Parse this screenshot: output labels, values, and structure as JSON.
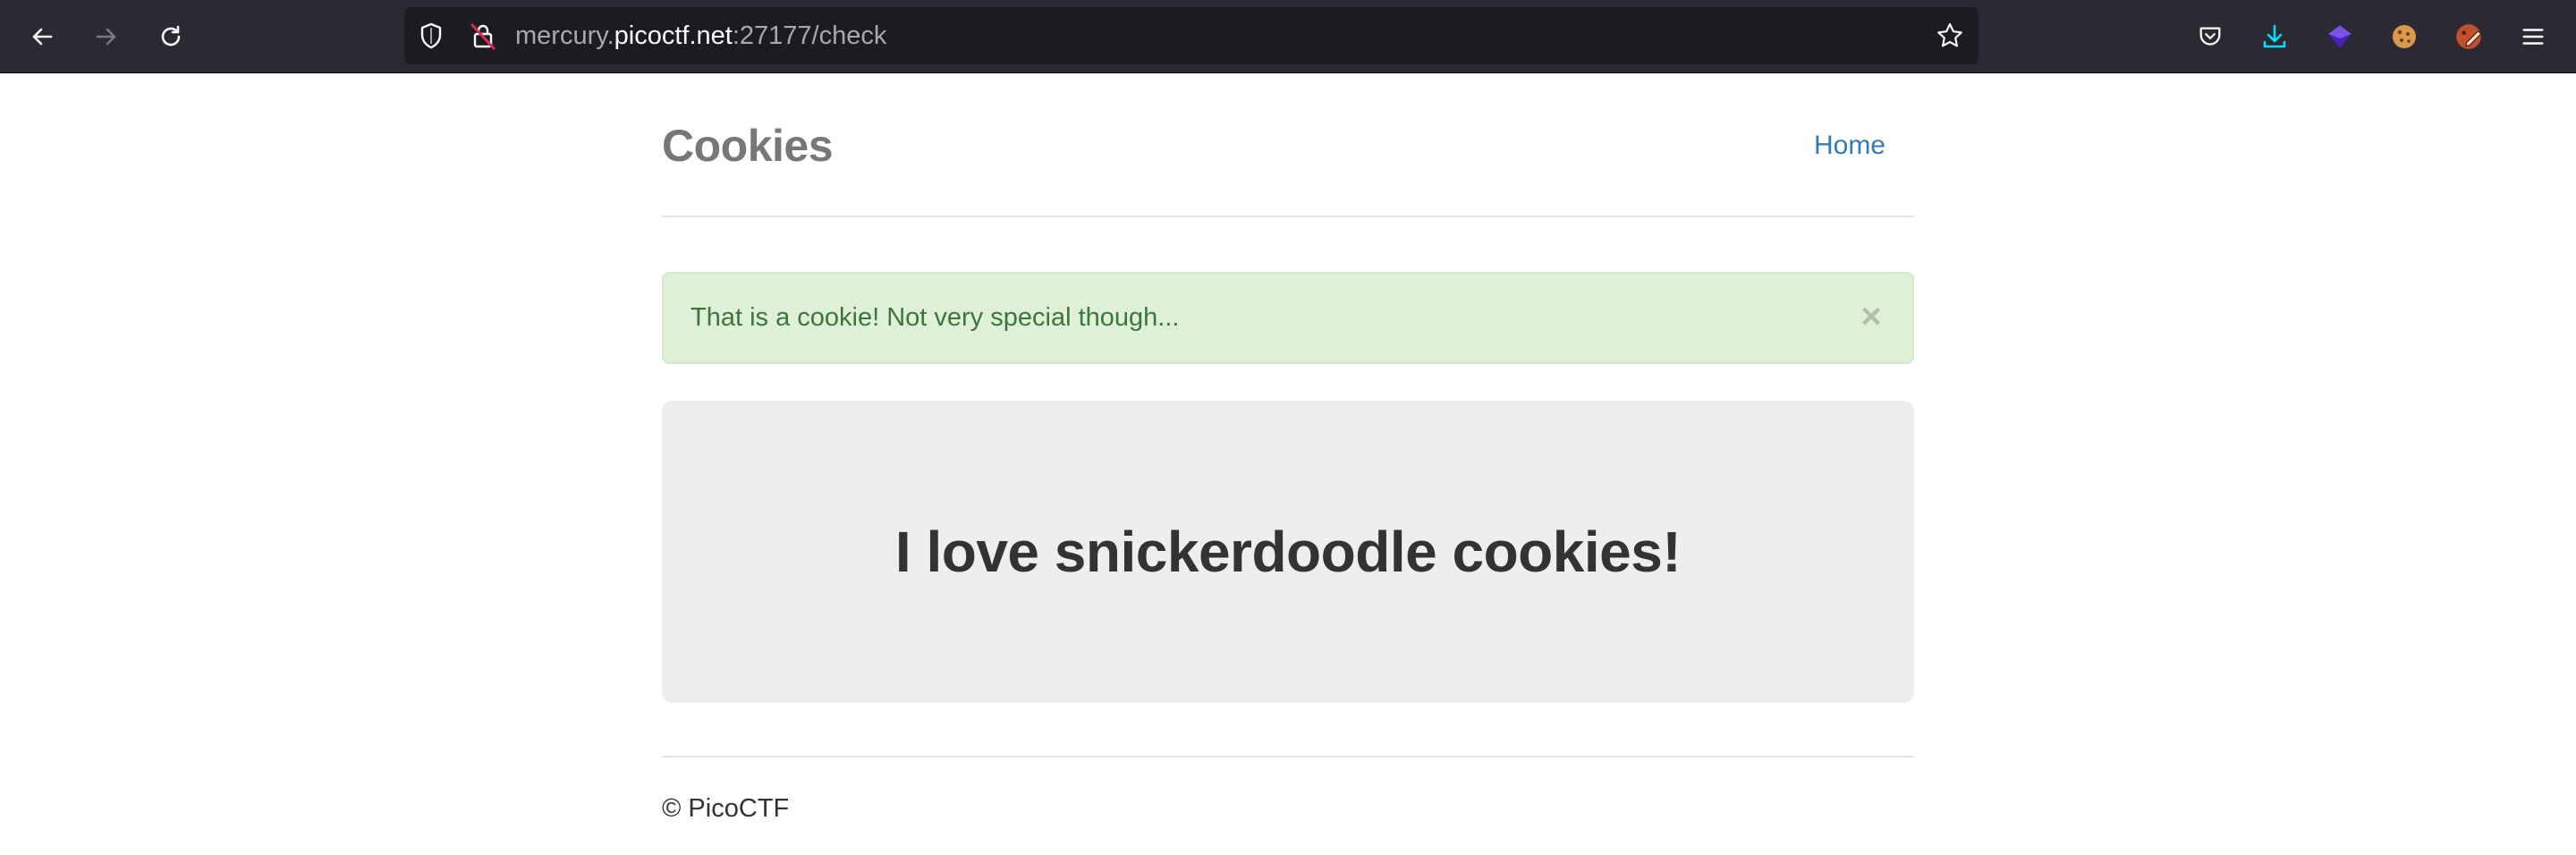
{
  "browser": {
    "url": {
      "prefix": "mercury.",
      "domain": "picoctf.net",
      "suffix": ":27177/check"
    },
    "colors": {
      "toolbar_bg": "#2b2a33",
      "urlbar_bg": "#1c1b22",
      "download_accent": "#00ddff"
    },
    "icons": {
      "back": "back-arrow-icon",
      "forward": "forward-arrow-icon",
      "reload": "reload-icon",
      "tracking": "shield-icon",
      "insecure": "insecure-lock-icon",
      "bookmark": "star-icon",
      "pocket": "pocket-icon",
      "downloads": "download-icon",
      "extension_1": "purple-gem-extension-icon",
      "extension_2": "cookie-extension-icon",
      "extension_3": "cookie-editor-extension-icon",
      "menu": "hamburger-menu-icon"
    }
  },
  "page": {
    "site_title": "Cookies",
    "nav_home": "Home",
    "alert": {
      "message": "That is a cookie! Not very special though...",
      "close": "×"
    },
    "jumbotron": "I love snickerdoodle cookies!",
    "footer": "© PicoCTF",
    "colors": {
      "link": "#337ab7",
      "alert_bg": "#dff0d8",
      "alert_text": "#3c763d",
      "jumbotron_bg": "#eeeeee"
    }
  }
}
